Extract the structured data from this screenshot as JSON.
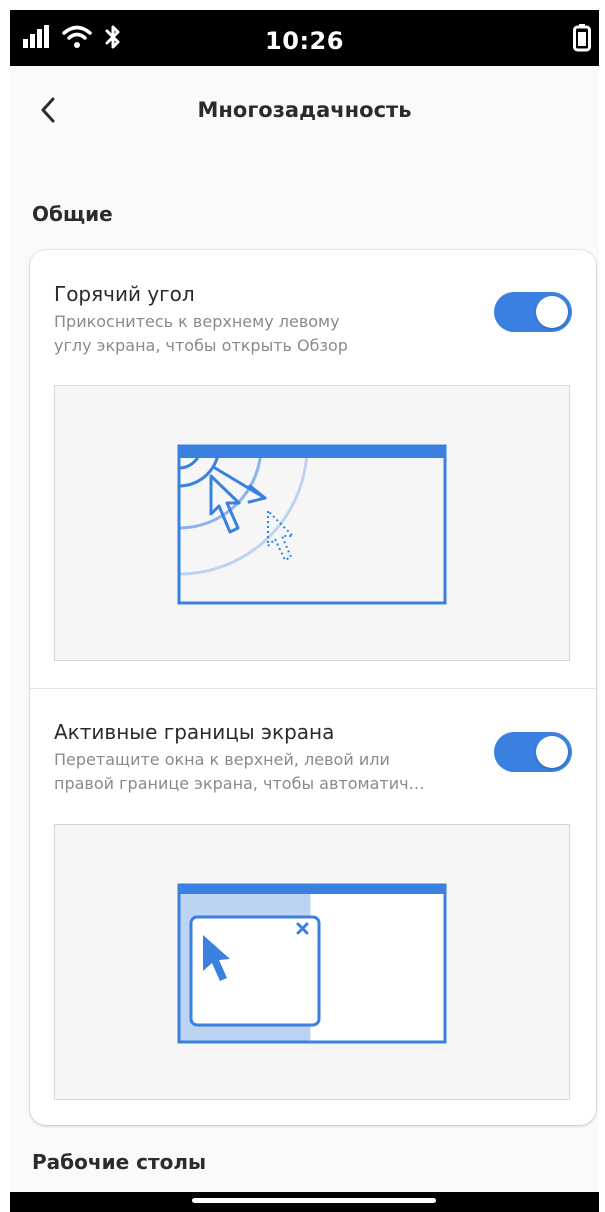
{
  "status": {
    "time": "10:26",
    "icons": [
      "signal-icon",
      "wifi-icon",
      "bluetooth-icon",
      "battery-icon"
    ]
  },
  "header": {
    "title": "Многозадачность"
  },
  "sections": {
    "general": {
      "title": "Общие",
      "hot_corner": {
        "title": "Горячий угол",
        "subtitle_line1": "Прикоснитесь к верхнему левому",
        "subtitle_line2": "углу экрана, чтобы открыть Обзор",
        "enabled": true
      },
      "active_edges": {
        "title": "Активные границы экрана",
        "subtitle_line1": "Перетащите окна к верхней, левой или",
        "subtitle_line2": "правой границе экрана, чтобы автоматич…",
        "enabled": true
      }
    },
    "workspaces": {
      "title": "Рабочие столы"
    }
  },
  "colors": {
    "accent": "#3a80e0",
    "accent_light": "#bcd4f2"
  }
}
